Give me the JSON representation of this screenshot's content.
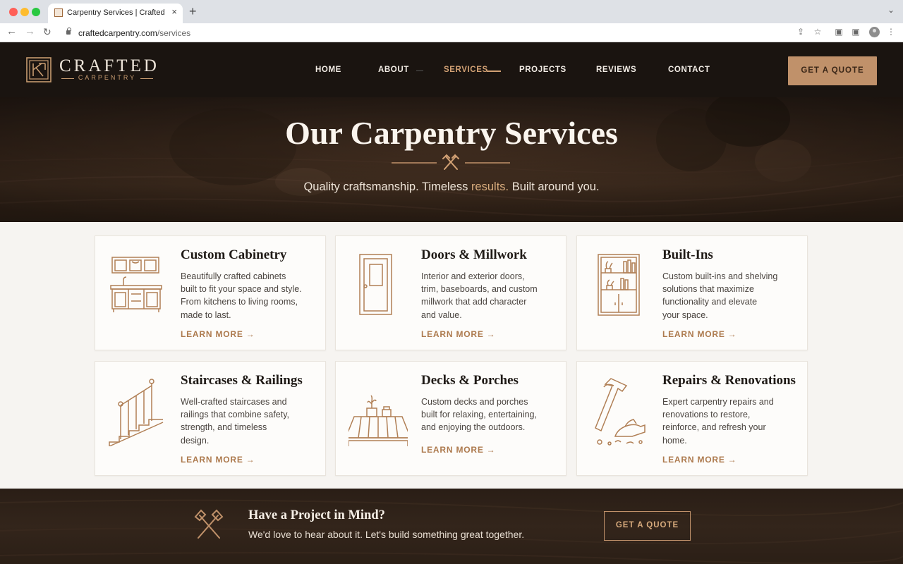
{
  "browser": {
    "tab_title": "Carpentry Services | Crafted",
    "tab_close": "×",
    "new_tab": "+",
    "url_domain": "craftedcarpentry.com",
    "url_path": "/services"
  },
  "header": {
    "logo_word": "CRAFTED",
    "logo_sub": "CARPENTRY",
    "nav": [
      {
        "label": "HOME"
      },
      {
        "label": "ABOUT"
      },
      {
        "label": "SERVICES",
        "active": true
      },
      {
        "label": "PROJECTS"
      },
      {
        "label": "REVIEWS"
      },
      {
        "label": "CONTACT"
      }
    ],
    "cta_label": "GET A QUOTE"
  },
  "hero": {
    "title": "Our Carpentry Services",
    "subtitle_pre": "Quality craftsmanship. Timeless ",
    "subtitle_accent": "results.",
    "subtitle_post": " Built around you."
  },
  "services": [
    {
      "title": "Custom Cabinetry",
      "icon": "cabinet-icon",
      "lines": [
        "Beautifully crafted cabinets",
        "built to fit your space and style.",
        "From kitchens to living rooms,",
        "made to last."
      ],
      "link": "LEARN MORE"
    },
    {
      "title": "Doors & Millwork",
      "icon": "door-icon",
      "lines": [
        "Interior and exterior doors,",
        "trim, baseboards, and custom",
        "millwork that add character",
        "and value."
      ],
      "link": "LEARN MORE"
    },
    {
      "title": "Built-Ins",
      "icon": "bookshelf-icon",
      "lines": [
        "Custom built-ins and shelving",
        "solutions that maximize",
        "functionality and elevate",
        "your space."
      ],
      "link": "LEARN MORE"
    },
    {
      "title": "Staircases & Railings",
      "icon": "staircase-icon",
      "lines": [
        "Well-crafted staircases and",
        "railings that combine safety,",
        "strength, and timeless",
        "design."
      ],
      "link": "LEARN MORE"
    },
    {
      "title": "Decks & Porches",
      "icon": "deck-icon",
      "lines": [
        "Custom decks and porches",
        "built for relaxing, entertaining,",
        "and enjoying the outdoors."
      ],
      "link": "LEARN MORE"
    },
    {
      "title": "Repairs & Renovations",
      "icon": "hammer-plane-icon",
      "lines": [
        "Expert carpentry repairs and",
        "renovations to restore,",
        "reinforce, and refresh your",
        "home."
      ],
      "link": "LEARN MORE"
    }
  ],
  "cta": {
    "title": "Have a Project in Mind?",
    "text": "We'd love to hear about it. Let's build something great together.",
    "button": "GET A QUOTE"
  },
  "colors": {
    "accent": "#c0916a",
    "accent_text": "#ad7a4e",
    "header_bg": "#1a1410",
    "page_bg": "#f6f4f1"
  }
}
